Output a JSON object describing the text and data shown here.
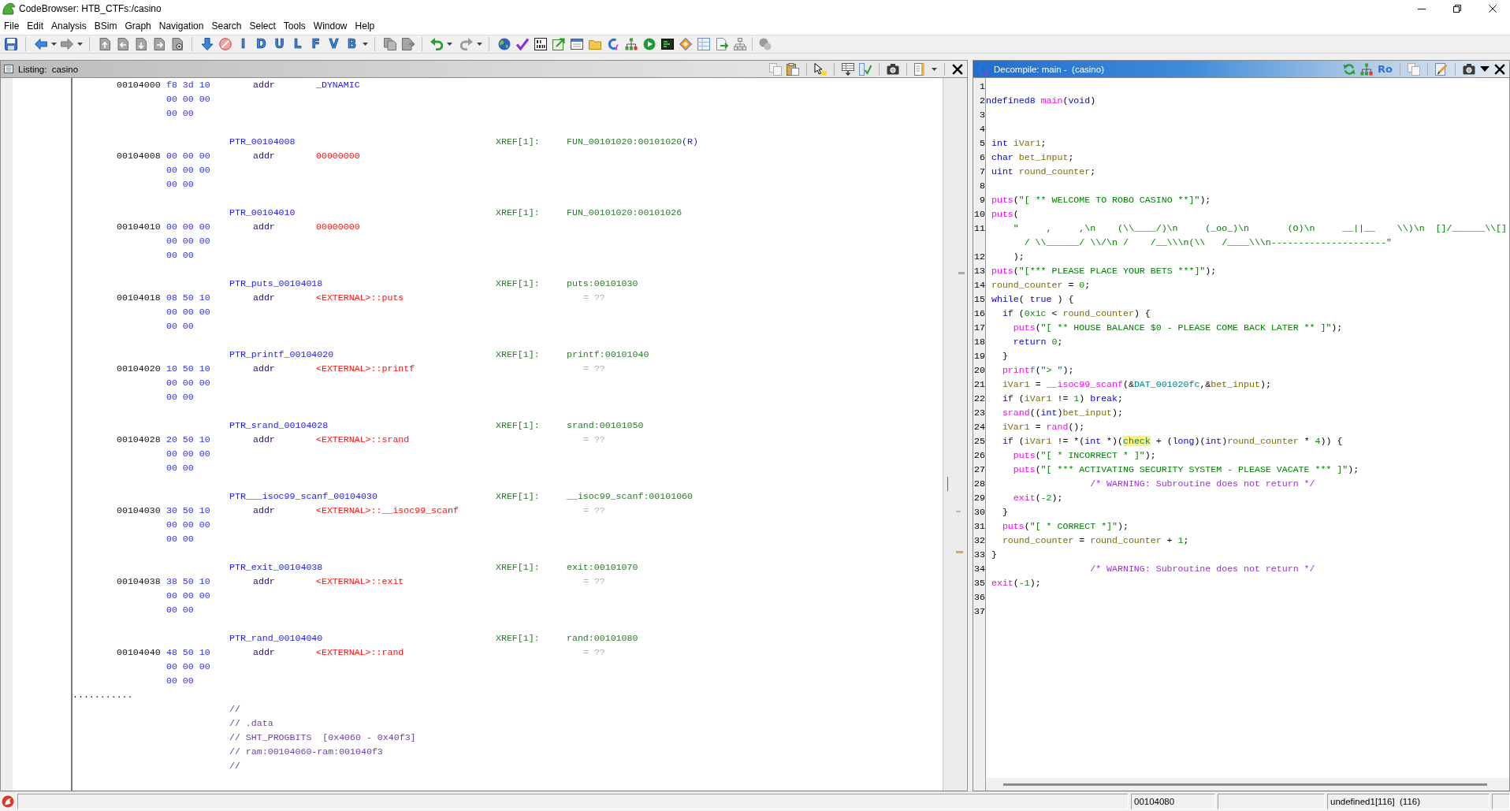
{
  "window": {
    "title": "CodeBrowser: HTB_CTFs:/casino"
  },
  "menu": [
    "File",
    "Edit",
    "Analysis",
    "BSim",
    "Graph",
    "Navigation",
    "Search",
    "Select",
    "Tools",
    "Window",
    "Help"
  ],
  "toolbar": {
    "letter_buttons": [
      "I",
      "D",
      "U",
      "L",
      "F",
      "V",
      "B"
    ]
  },
  "listing": {
    "title": "Listing:  casino",
    "focused": false,
    "entries": [
      {
        "address": "00104000",
        "bytes": [
          "f8 3d 10",
          "00 00 00",
          "00 00"
        ],
        "mnemonic": "addr",
        "operand": {
          "text": "_DYNAMIC",
          "kind": "symbol"
        }
      },
      {
        "label": "PTR_00104008",
        "xref": "XREF[1]:",
        "xref_target": "FUN_00101020:00101020",
        "xref_type": "(R)",
        "address": "00104008",
        "bytes": [
          "00 00 00",
          "00 00 00",
          "00 00"
        ],
        "mnemonic": "addr",
        "operand": {
          "text": "00000000",
          "kind": "invalid"
        }
      },
      {
        "label": "PTR_00104010",
        "xref": "XREF[1]:",
        "xref_target": "FUN_00101020:00101026",
        "address": "00104010",
        "bytes": [
          "00 00 00",
          "00 00 00",
          "00 00"
        ],
        "mnemonic": "addr",
        "operand": {
          "text": "00000000",
          "kind": "invalid"
        }
      },
      {
        "label": "PTR_puts_00104018",
        "xref": "XREF[1]:",
        "xref_target": "puts:00101030",
        "address": "00104018",
        "bytes": [
          "08 50 10",
          "00 00 00",
          "00 00"
        ],
        "mnemonic": "addr",
        "operand": {
          "text": "<EXTERNAL>::puts",
          "kind": "external"
        },
        "value": "= ??"
      },
      {
        "label": "PTR_printf_00104020",
        "xref": "XREF[1]:",
        "xref_target": "printf:00101040",
        "address": "00104020",
        "bytes": [
          "10 50 10",
          "00 00 00",
          "00 00"
        ],
        "mnemonic": "addr",
        "operand": {
          "text": "<EXTERNAL>::printf",
          "kind": "external"
        },
        "value": "= ??"
      },
      {
        "label": "PTR_srand_00104028",
        "xref": "XREF[1]:",
        "xref_target": "srand:00101050",
        "address": "00104028",
        "bytes": [
          "20 50 10",
          "00 00 00",
          "00 00"
        ],
        "mnemonic": "addr",
        "operand": {
          "text": "<EXTERNAL>::srand",
          "kind": "external"
        },
        "value": "= ??"
      },
      {
        "label": "PTR___isoc99_scanf_00104030",
        "xref": "XREF[1]:",
        "xref_target": "__isoc99_scanf:00101060",
        "address": "00104030",
        "bytes": [
          "30 50 10",
          "00 00 00",
          "00 00"
        ],
        "mnemonic": "addr",
        "operand": {
          "text": "<EXTERNAL>::__isoc99_scanf",
          "kind": "external"
        },
        "value": "= ??"
      },
      {
        "label": "PTR_exit_00104038",
        "xref": "XREF[1]:",
        "xref_target": "exit:00101070",
        "address": "00104038",
        "bytes": [
          "38 50 10",
          "00 00 00",
          "00 00"
        ],
        "mnemonic": "addr",
        "operand": {
          "text": "<EXTERNAL>::exit",
          "kind": "external"
        },
        "value": "= ??"
      },
      {
        "label": "PTR_rand_00104040",
        "xref": "XREF[1]:",
        "xref_target": "rand:00101080",
        "address": "00104040",
        "bytes": [
          "48 50 10",
          "00 00 00",
          "00 00"
        ],
        "mnemonic": "addr",
        "operand": {
          "text": "<EXTERNAL>::rand",
          "kind": "external"
        },
        "value": "= ??"
      }
    ],
    "separator": "...........",
    "comments": [
      "//",
      "// .data",
      "// SHT_PROGBITS  [0x4060 - 0x40f3]",
      "// ram:00104060-ram:001040f3",
      "//"
    ]
  },
  "decompiler": {
    "title": "Decompile: main -  (casino)",
    "focused": true,
    "toggle_label": "Ro",
    "lines": [
      {
        "number": "1"
      },
      {
        "number": "2",
        "tokens": [
          {
            "text": "ndefined8 ",
            "kind": "type"
          },
          {
            "text": "main",
            "kind": "function"
          },
          {
            "text": "(",
            "kind": "plain"
          },
          {
            "text": "void",
            "kind": "type"
          },
          {
            "text": ")",
            "kind": "plain"
          }
        ]
      },
      {
        "number": "3"
      },
      {
        "number": "4"
      },
      {
        "number": "5",
        "tokens": [
          {
            "text": " int ",
            "kind": "type"
          },
          {
            "text": "iVar1",
            "kind": "variable"
          },
          {
            "text": ";",
            "kind": "plain"
          }
        ]
      },
      {
        "number": "6",
        "tokens": [
          {
            "text": " char ",
            "kind": "type"
          },
          {
            "text": "bet_input",
            "kind": "variable"
          },
          {
            "text": ";",
            "kind": "plain"
          }
        ]
      },
      {
        "number": "7",
        "tokens": [
          {
            "text": " uint ",
            "kind": "type"
          },
          {
            "text": "round_counter",
            "kind": "variable"
          },
          {
            "text": ";",
            "kind": "plain"
          }
        ]
      },
      {
        "number": "8"
      },
      {
        "number": "9",
        "tokens": [
          {
            "text": " puts",
            "kind": "function"
          },
          {
            "text": "(",
            "kind": "plain"
          },
          {
            "text": "\"[ ** WELCOME TO ROBO CASINO **]\"",
            "kind": "string"
          },
          {
            "text": ");",
            "kind": "plain"
          }
        ]
      },
      {
        "number": "10",
        "tokens": [
          {
            "text": " puts",
            "kind": "function"
          },
          {
            "text": "(",
            "kind": "plain"
          }
        ]
      },
      {
        "number": "11",
        "tokens": [
          {
            "text": "     \"     ,     ,\\n    (\\\\____/)\\n     (_oo_)\\n       (O)\\n     __||__    \\\\)\\n  []/______\\\\[]",
            "kind": "string"
          }
        ],
        "wrapped": [
          {
            "text": "       / \\\\______/ \\\\/\\n /    /__\\\\\\n(\\\\   /____\\\\\\n---------------------\"",
            "kind": "string"
          }
        ]
      },
      {
        "number": "12",
        "tokens": [
          {
            "text": "     );",
            "kind": "plain"
          }
        ]
      },
      {
        "number": "13",
        "tokens": [
          {
            "text": " puts",
            "kind": "function"
          },
          {
            "text": "(",
            "kind": "plain"
          },
          {
            "text": "\"[*** PLEASE PLACE YOUR BETS ***]\"",
            "kind": "string"
          },
          {
            "text": ");",
            "kind": "plain"
          }
        ]
      },
      {
        "number": "14",
        "tokens": [
          {
            "text": " round_counter",
            "kind": "variable"
          },
          {
            "text": " = ",
            "kind": "plain"
          },
          {
            "text": "0",
            "kind": "constant"
          },
          {
            "text": ";",
            "kind": "plain"
          }
        ]
      },
      {
        "number": "15",
        "tokens": [
          {
            "text": " while",
            "kind": "keyword"
          },
          {
            "text": "( ",
            "kind": "plain"
          },
          {
            "text": "true",
            "kind": "keyword"
          },
          {
            "text": " ) {",
            "kind": "plain"
          }
        ]
      },
      {
        "number": "16",
        "tokens": [
          {
            "text": "   if",
            "kind": "keyword"
          },
          {
            "text": " (",
            "kind": "plain"
          },
          {
            "text": "0x1c",
            "kind": "constant"
          },
          {
            "text": " < ",
            "kind": "plain"
          },
          {
            "text": "round_counter",
            "kind": "variable"
          },
          {
            "text": ") {",
            "kind": "plain"
          }
        ]
      },
      {
        "number": "17",
        "tokens": [
          {
            "text": "     puts",
            "kind": "function"
          },
          {
            "text": "(",
            "kind": "plain"
          },
          {
            "text": "\"[ ** HOUSE BALANCE $0 - PLEASE COME BACK LATER ** ]\"",
            "kind": "string"
          },
          {
            "text": ");",
            "kind": "plain"
          }
        ]
      },
      {
        "number": "18",
        "tokens": [
          {
            "text": "     return ",
            "kind": "keyword"
          },
          {
            "text": "0",
            "kind": "constant"
          },
          {
            "text": ";",
            "kind": "plain"
          }
        ]
      },
      {
        "number": "19",
        "tokens": [
          {
            "text": "   }",
            "kind": "plain"
          }
        ]
      },
      {
        "number": "20",
        "tokens": [
          {
            "text": "   printf",
            "kind": "function"
          },
          {
            "text": "(",
            "kind": "plain"
          },
          {
            "text": "\"> \"",
            "kind": "string"
          },
          {
            "text": ");",
            "kind": "plain"
          }
        ]
      },
      {
        "number": "21",
        "tokens": [
          {
            "text": "   iVar1",
            "kind": "variable"
          },
          {
            "text": " = ",
            "kind": "plain"
          },
          {
            "text": "__isoc99_scanf",
            "kind": "function"
          },
          {
            "text": "(&",
            "kind": "plain"
          },
          {
            "text": "DAT_001020fc",
            "kind": "global"
          },
          {
            "text": ",&",
            "kind": "plain"
          },
          {
            "text": "bet_input",
            "kind": "variable"
          },
          {
            "text": ");",
            "kind": "plain"
          }
        ]
      },
      {
        "number": "22",
        "tokens": [
          {
            "text": "   if",
            "kind": "keyword"
          },
          {
            "text": " (",
            "kind": "plain"
          },
          {
            "text": "iVar1",
            "kind": "variable"
          },
          {
            "text": " != ",
            "kind": "plain"
          },
          {
            "text": "1",
            "kind": "constant"
          },
          {
            "text": ") ",
            "kind": "plain"
          },
          {
            "text": "break",
            "kind": "keyword"
          },
          {
            "text": ";",
            "kind": "plain"
          }
        ]
      },
      {
        "number": "23",
        "tokens": [
          {
            "text": "   srand",
            "kind": "function"
          },
          {
            "text": "((",
            "kind": "plain"
          },
          {
            "text": "int",
            "kind": "type"
          },
          {
            "text": ")",
            "kind": "plain"
          },
          {
            "text": "bet_input",
            "kind": "variable"
          },
          {
            "text": ");",
            "kind": "plain"
          }
        ]
      },
      {
        "number": "24",
        "tokens": [
          {
            "text": "   iVar1",
            "kind": "variable"
          },
          {
            "text": " = ",
            "kind": "plain"
          },
          {
            "text": "rand",
            "kind": "function"
          },
          {
            "text": "();",
            "kind": "plain"
          }
        ]
      },
      {
        "number": "25",
        "tokens": [
          {
            "text": "   if",
            "kind": "keyword"
          },
          {
            "text": " (",
            "kind": "plain"
          },
          {
            "text": "iVar1",
            "kind": "variable"
          },
          {
            "text": " != *(",
            "kind": "plain"
          },
          {
            "text": "int",
            "kind": "type"
          },
          {
            "text": " *)(",
            "kind": "plain"
          },
          {
            "text": "check",
            "kind": "highlight"
          },
          {
            "text": " + (",
            "kind": "plain"
          },
          {
            "text": "long",
            "kind": "type"
          },
          {
            "text": ")(",
            "kind": "plain"
          },
          {
            "text": "int",
            "kind": "type"
          },
          {
            "text": ")",
            "kind": "plain"
          },
          {
            "text": "round_counter",
            "kind": "variable"
          },
          {
            "text": " * ",
            "kind": "plain"
          },
          {
            "text": "4",
            "kind": "constant"
          },
          {
            "text": ")) {",
            "kind": "plain"
          }
        ]
      },
      {
        "number": "26",
        "tokens": [
          {
            "text": "     puts",
            "kind": "function"
          },
          {
            "text": "(",
            "kind": "plain"
          },
          {
            "text": "\"[ * INCORRECT * ]\"",
            "kind": "string"
          },
          {
            "text": ");",
            "kind": "plain"
          }
        ]
      },
      {
        "number": "27",
        "tokens": [
          {
            "text": "     puts",
            "kind": "function"
          },
          {
            "text": "(",
            "kind": "plain"
          },
          {
            "text": "\"[ *** ACTIVATING SECURITY SYSTEM - PLEASE VACATE *** ]\"",
            "kind": "string"
          },
          {
            "text": ");",
            "kind": "plain"
          }
        ]
      },
      {
        "number": "28",
        "tokens": [
          {
            "text": "                   /* WARNING: Subroutine does not return */",
            "kind": "comment"
          }
        ]
      },
      {
        "number": "29",
        "tokens": [
          {
            "text": "     exit",
            "kind": "function"
          },
          {
            "text": "(",
            "kind": "plain"
          },
          {
            "text": "-2",
            "kind": "constant"
          },
          {
            "text": ");",
            "kind": "plain"
          }
        ]
      },
      {
        "number": "30",
        "tokens": [
          {
            "text": "   }",
            "kind": "plain"
          }
        ]
      },
      {
        "number": "31",
        "tokens": [
          {
            "text": "   puts",
            "kind": "function"
          },
          {
            "text": "(",
            "kind": "plain"
          },
          {
            "text": "\"[ * CORRECT *]\"",
            "kind": "string"
          },
          {
            "text": ");",
            "kind": "plain"
          }
        ]
      },
      {
        "number": "32",
        "tokens": [
          {
            "text": "   round_counter",
            "kind": "variable"
          },
          {
            "text": " = ",
            "kind": "plain"
          },
          {
            "text": "round_counter",
            "kind": "variable"
          },
          {
            "text": " + ",
            "kind": "plain"
          },
          {
            "text": "1",
            "kind": "constant"
          },
          {
            "text": ";",
            "kind": "plain"
          }
        ]
      },
      {
        "number": "33",
        "tokens": [
          {
            "text": " }",
            "kind": "plain"
          }
        ]
      },
      {
        "number": "34",
        "tokens": [
          {
            "text": "                   /* WARNING: Subroutine does not return */",
            "kind": "comment"
          }
        ]
      },
      {
        "number": "35",
        "tokens": [
          {
            "text": " exit",
            "kind": "function"
          },
          {
            "text": "(",
            "kind": "plain"
          },
          {
            "text": "-1",
            "kind": "constant"
          },
          {
            "text": ");",
            "kind": "plain"
          }
        ]
      },
      {
        "number": "36"
      },
      {
        "number": "37"
      }
    ]
  },
  "status_bar": {
    "address": "00104080",
    "data_type": "undefined1[116]  (116)"
  }
}
